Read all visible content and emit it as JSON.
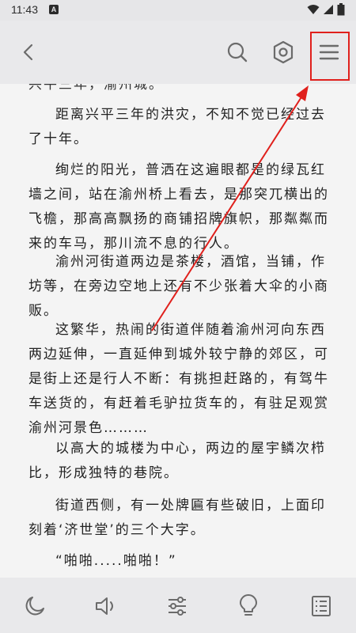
{
  "status": {
    "time": "11:43",
    "notification_icon": "A"
  },
  "toolbar": {
    "back_icon": "chevron-left-icon",
    "search_icon": "search-icon",
    "settings_icon": "hexagon-settings-icon",
    "menu_icon": "hamburger-menu-icon"
  },
  "content": {
    "cut_line": "兴平三年，渝州城。",
    "paragraphs": [
      "距离兴平三年的洪灾，不知不觉已经过去了十年。",
      "绚烂的阳光，普洒在这遍眼都是的绿瓦红墙之间，站在渝州桥上看去，是那突兀横出的飞檐，那高高飘扬的商铺招牌旗帜，那粼粼而来的车马，那川流不息的行人。",
      "渝州河街道两边是茶楼，酒馆，当铺，作坊等，在旁边空地上还有不少张着大伞的小商贩。",
      "这繁华，热闹的街道伴随着渝州河向东西两边延伸，一直延伸到城外较宁静的郊区，可是街上还是行人不断：有挑担赶路的，有驾牛车送货的，有赶着毛驴拉货车的，有驻足观赏渝州河景色………",
      "以高大的城楼为中心，两边的屋宇鳞次栉比，形成独特的巷院。",
      "街道西侧，有一处牌匾有些破旧，上面印刻着‘济世堂’的三个大字。",
      "“啪啪.....啪啪！”"
    ]
  },
  "bottombar": {
    "icons": [
      "moon-icon",
      "speaker-icon",
      "sliders-icon",
      "lightbulb-icon",
      "catalog-list-icon"
    ]
  },
  "colors": {
    "annotation_red": "#e0201c",
    "icon_gray": "#6b6b6b",
    "bar_bg": "#e9e9eb",
    "page_bg": "#f4f4f4"
  }
}
